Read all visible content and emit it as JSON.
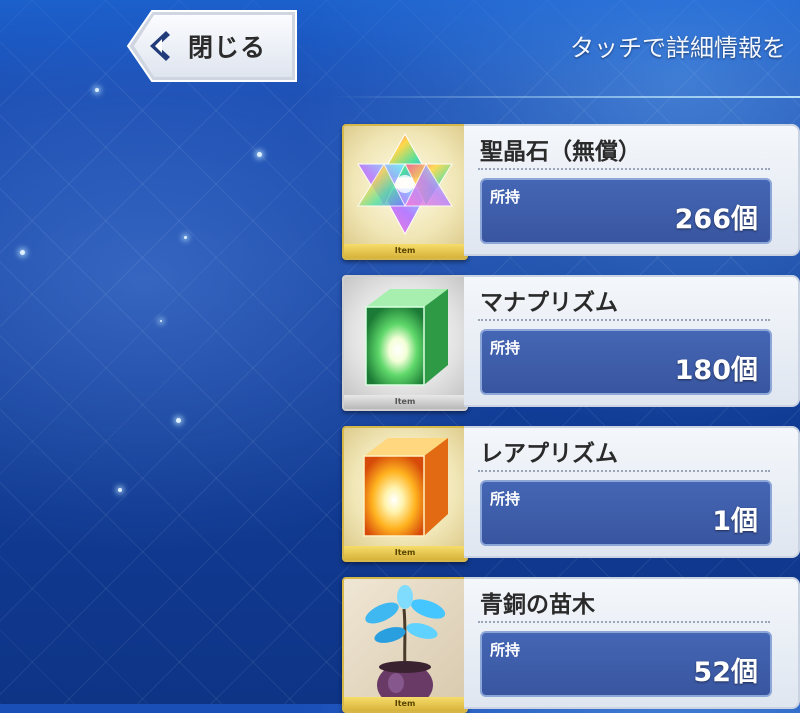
{
  "header": {
    "close_label": "閉じる",
    "hint": "タッチで詳細情報を"
  },
  "colors": {
    "background": "#143f9e",
    "panel": "#eef2f8",
    "count_box": "#3f5eac",
    "tag_gold": "#e6c44e",
    "tag_silver": "#c9c9c9"
  },
  "items": [
    {
      "name": "聖晶石（無償）",
      "owned_label": "所持",
      "count": "266個",
      "tag": "Item",
      "icon": "saint-quartz-icon"
    },
    {
      "name": "マナプリズム",
      "owned_label": "所持",
      "count": "180個",
      "tag": "Item",
      "icon": "green-prism-icon"
    },
    {
      "name": "レアプリズム",
      "owned_label": "所持",
      "count": "1個",
      "tag": "Item",
      "icon": "orange-prism-icon"
    },
    {
      "name": "青銅の苗木",
      "owned_label": "所持",
      "count": "52個",
      "tag": "Item",
      "icon": "bronze-sapling-icon"
    }
  ]
}
